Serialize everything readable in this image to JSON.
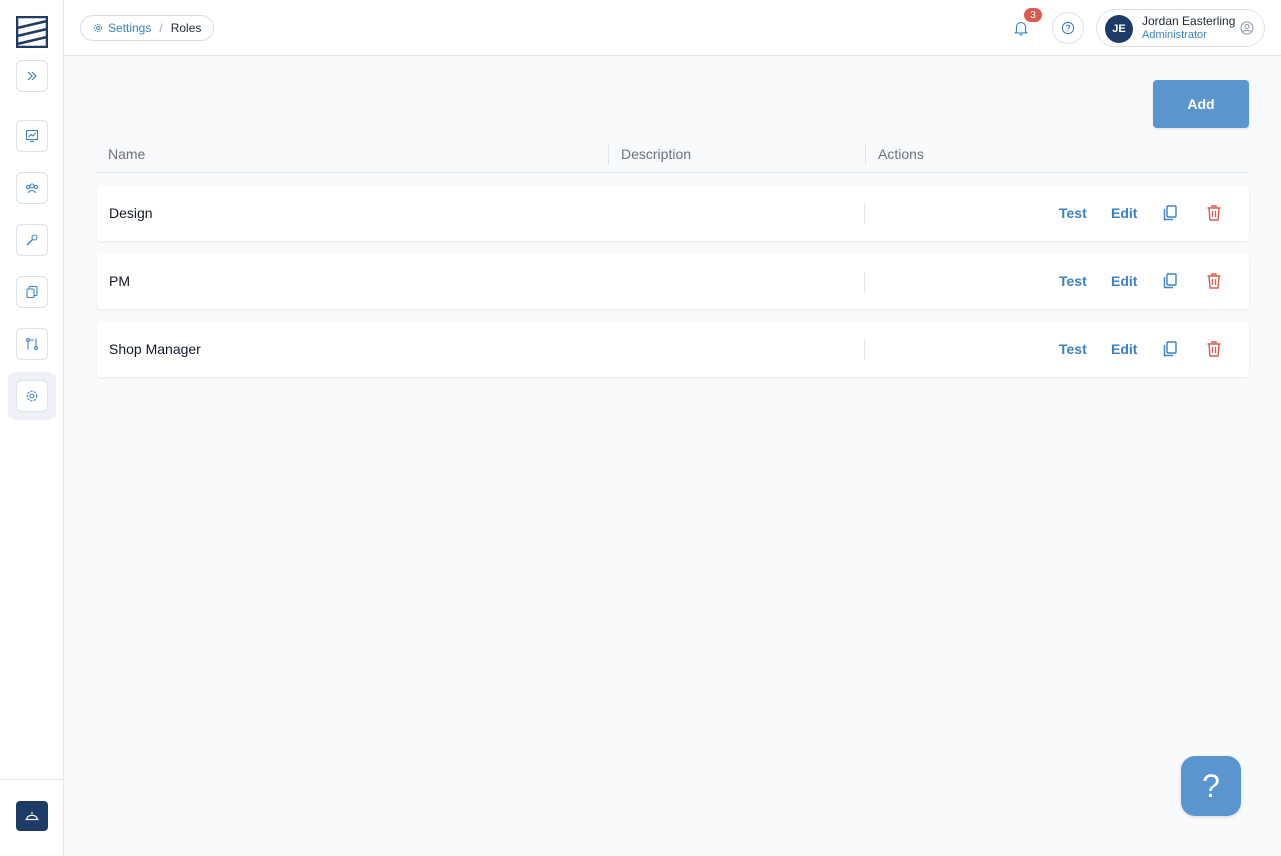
{
  "breadcrumb": {
    "parent": "Settings",
    "separator": "/",
    "current": "Roles"
  },
  "header": {
    "notification_count": "3",
    "user": {
      "initials": "JE",
      "name": "Jordan Easterling",
      "role": "Administrator"
    }
  },
  "sidebar": {
    "items": [
      {
        "icon": "expand-chevrons-icon"
      },
      {
        "icon": "dashboard-chart-icon"
      },
      {
        "icon": "team-users-icon"
      },
      {
        "icon": "wrench-icon"
      },
      {
        "icon": "documents-icon"
      },
      {
        "icon": "workflow-icon"
      },
      {
        "icon": "gear-icon",
        "active": true
      }
    ],
    "bottom_icon": "hard-hat-icon"
  },
  "main": {
    "add_label": "Add",
    "columns": [
      "Name",
      "Description",
      "Actions"
    ],
    "rows": [
      {
        "name": "Design",
        "test": "Test",
        "edit": "Edit"
      },
      {
        "name": "PM",
        "test": "Test",
        "edit": "Edit"
      },
      {
        "name": "Shop Manager",
        "test": "Test",
        "edit": "Edit"
      }
    ]
  },
  "help_fab_label": "?",
  "colors": {
    "accent": "#3b82c4",
    "primary_button": "#5b95d0",
    "navy": "#1e3a66",
    "danger": "#dc5b4f"
  }
}
